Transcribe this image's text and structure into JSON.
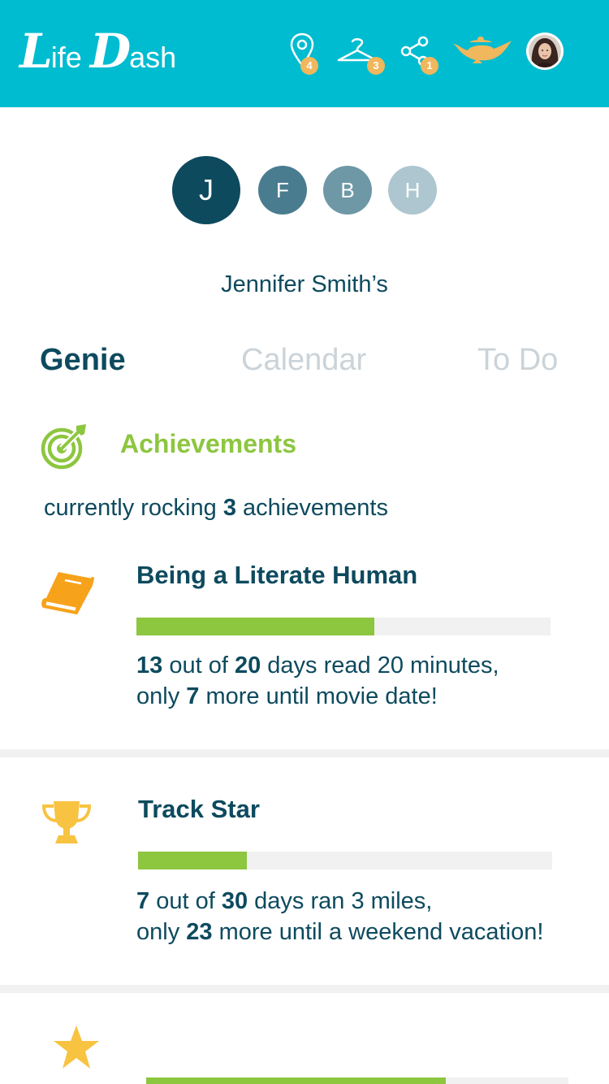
{
  "header": {
    "logo_big_1": "L",
    "logo_small_1": "ife",
    "logo_big_2": "D",
    "logo_small_2": "ash",
    "icons": [
      {
        "name": "location-pin-icon",
        "badge": "4"
      },
      {
        "name": "hanger-icon",
        "badge": "3"
      },
      {
        "name": "share-icon",
        "badge": "1"
      },
      {
        "name": "genie-lamp-icon"
      },
      {
        "name": "user-avatar"
      }
    ],
    "colors": {
      "bar": "#00bcd0",
      "badge": "#f0b75c",
      "lamp": "#f0b75c"
    }
  },
  "family": [
    {
      "initial": "J",
      "selected": true
    },
    {
      "initial": "F",
      "selected": false
    },
    {
      "initial": "B",
      "selected": false
    },
    {
      "initial": "H",
      "selected": false
    }
  ],
  "owner_label": "Jennifer Smith’s",
  "tabs": [
    {
      "label": "Genie",
      "active": true
    },
    {
      "label": "Calendar",
      "active": false
    },
    {
      "label": "To Do",
      "active": false
    }
  ],
  "achievements": {
    "icon": "target-icon",
    "title": "Achievements",
    "summary_prefix": "currently rocking",
    "summary_count": "3",
    "summary_suffix": "achievements",
    "items": [
      {
        "icon": "book-icon",
        "title": "Being a Literate Human",
        "done": "13",
        "out_of": "out of",
        "total": "20",
        "activity": "days read 20 minutes,",
        "only": "only",
        "remaining": "7",
        "reward": "more until movie date!",
        "progress": 0.575
      },
      {
        "icon": "trophy-icon",
        "title": "Track Star",
        "done": "7",
        "out_of": "out of",
        "total": "30",
        "activity": "days ran 3 miles,",
        "only": "only",
        "remaining": "23",
        "reward": "more until a weekend vacation!",
        "progress": 0.263
      },
      {
        "icon": "star-icon",
        "progress": 0.71
      }
    ],
    "colors": {
      "accent_green": "#8dc63f",
      "icon_orange": "#f7a21b",
      "icon_gold": "#f7c341",
      "text": "#0d4a5e"
    }
  }
}
